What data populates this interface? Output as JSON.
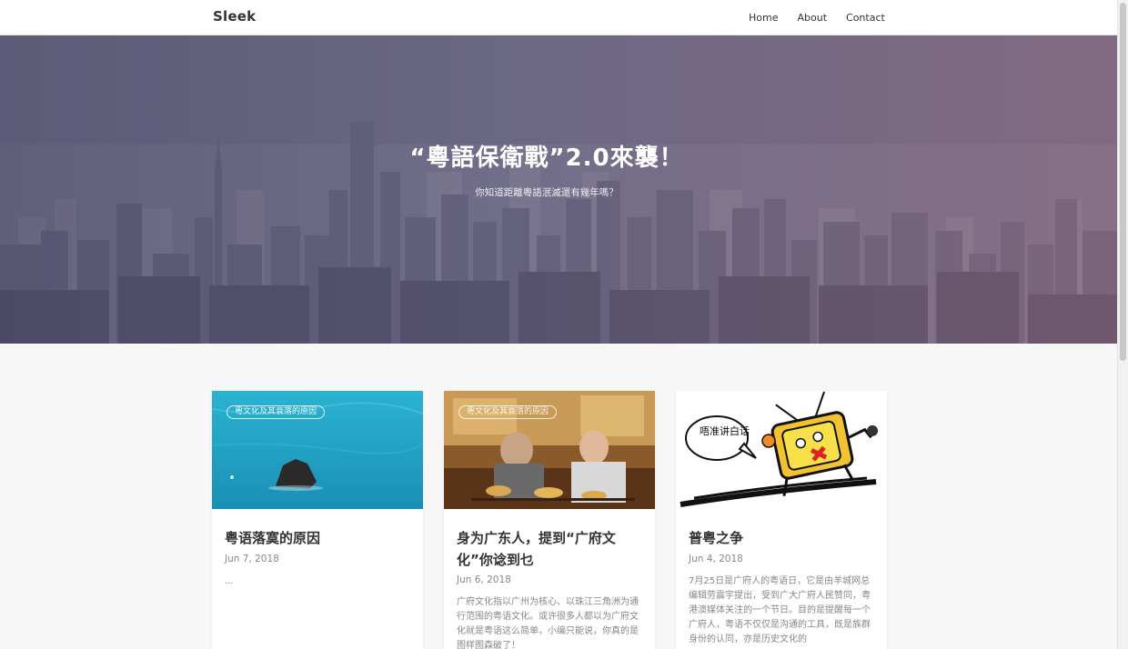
{
  "navbar": {
    "brand": "Sleek",
    "links": [
      "Home",
      "About",
      "Contact"
    ]
  },
  "hero": {
    "title": "“粵語保衛戰”2.0來襲！",
    "subtitle": "你知道距離粵語泯滅還有幾年嗎？"
  },
  "posts": [
    {
      "tag": "粵文化及其衰落的原因",
      "title": "粤语落寞的原因",
      "date": "Jun 7, 2018",
      "excerpt": "..."
    },
    {
      "tag": "粵文化及其衰落的原因",
      "title": "身为广东人，提到“广府文化”你谂到乜",
      "date": "Jun 6, 2018",
      "excerpt": "广府文化指以广州为核心、以珠江三角洲为通行范围的粤语文化。或许很多人都以为广府文化就是粤语这么简单，小编只能说，你真的是图样图森破了！"
    },
    {
      "tag": "",
      "title": "普粤之争",
      "date": "Jun 4, 2018",
      "excerpt": "7月25日是广府人的粤语日，它是由羊城网总编辑劳震宇提出，受到广大广府人民赞同，粤港澳媒体关注的一个节日。目的是提醒每一个广府人，粤语不仅仅是沟通的工具，既是族群身份的认同，亦是历史文化的"
    }
  ],
  "images": {
    "post_3_sign": "唔准讲白话"
  },
  "colors": {
    "accent": "#333333",
    "background": "#f7f7f7"
  }
}
